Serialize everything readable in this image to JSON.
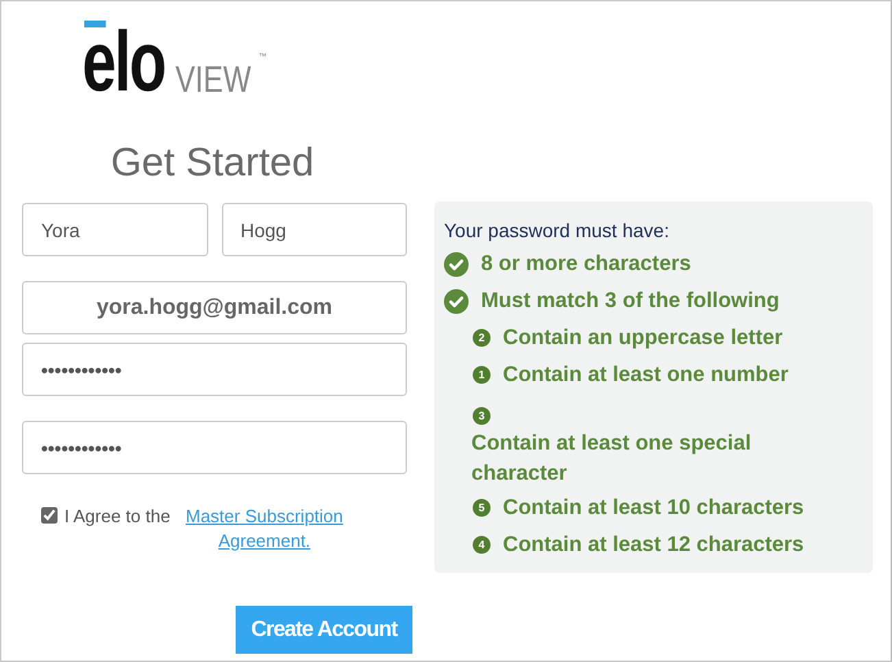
{
  "logo": {
    "brand": "elo",
    "product": "VIEW",
    "mark": "™"
  },
  "heading": "Get Started",
  "name_fields": [
    {
      "value": "Yora"
    },
    {
      "value": "Hogg"
    }
  ],
  "fields": [
    {
      "kind": "email",
      "value": "yora.hogg@gmail.com"
    },
    {
      "kind": "password",
      "value": "••••••••••••"
    },
    {
      "kind": "password",
      "value": "••••••••••••"
    }
  ],
  "agreement": {
    "checked": true,
    "text": "I Agree to the",
    "link": "Master Subscription Agreement."
  },
  "submit": "Create Account",
  "rules": {
    "title": "Your password must have:",
    "items": [
      {
        "kind": "check",
        "text": "8 or more characters"
      },
      {
        "kind": "check",
        "text": "Must match 3 of the following",
        "children": [
          {
            "kind": "inline",
            "badge": "2",
            "text": "Contain an uppercase letter"
          },
          {
            "kind": "inline",
            "badge": "1",
            "text": "Contain at least one number"
          },
          {
            "kind": "stacked",
            "badge": "3",
            "text": "Contain at least one special character"
          },
          {
            "kind": "inline",
            "badge": "5",
            "text": "Contain at least 10 characters"
          },
          {
            "kind": "inline",
            "badge": "4",
            "text": "Contain at least 12 characters"
          }
        ]
      }
    ]
  }
}
